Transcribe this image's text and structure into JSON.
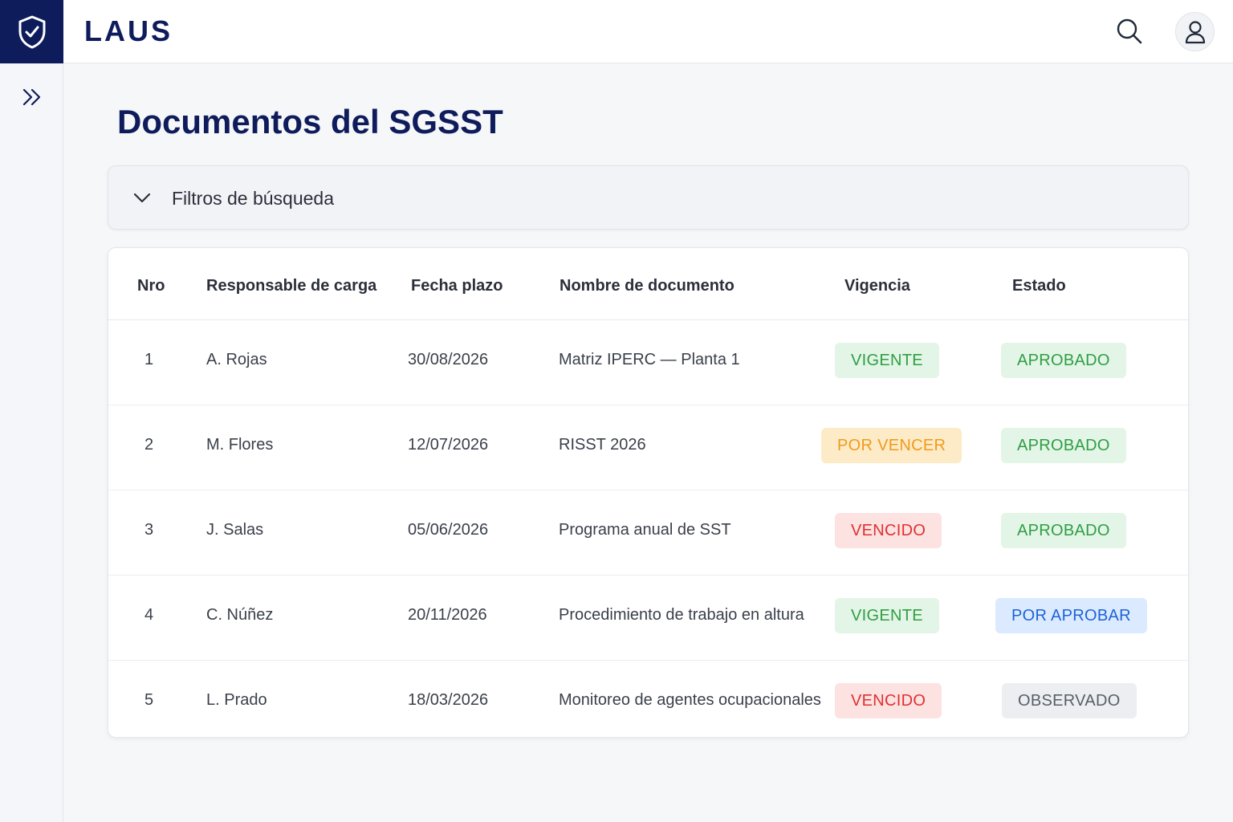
{
  "app": {
    "brand": "LAUS"
  },
  "page": {
    "title": "Documentos del SGSST"
  },
  "filters": {
    "label": "Filtros de búsqueda"
  },
  "table": {
    "headers": {
      "nro": "Nro",
      "responsable": "Responsable de carga",
      "fecha": "Fecha plazo",
      "nombre": "Nombre de documento",
      "vigencia": "Vigencia",
      "estado": "Estado"
    },
    "rows": [
      {
        "nro": "1",
        "responsable": "A. Rojas",
        "fecha": "30/08/2026",
        "nombre": "Matriz IPERC — Planta 1",
        "vigencia": "VIGENTE",
        "estado": "APROBADO"
      },
      {
        "nro": "2",
        "responsable": "M. Flores",
        "fecha": "12/07/2026",
        "nombre": "RISST 2026",
        "vigencia": "POR VENCER",
        "estado": "APROBADO"
      },
      {
        "nro": "3",
        "responsable": "J. Salas",
        "fecha": "05/06/2026",
        "nombre": "Programa anual de SST",
        "vigencia": "VENCIDO",
        "estado": "APROBADO"
      },
      {
        "nro": "4",
        "responsable": "C. Núñez",
        "fecha": "20/11/2026",
        "nombre": "Procedimiento de trabajo en altura",
        "vigencia": "VIGENTE",
        "estado": "POR APROBAR"
      },
      {
        "nro": "5",
        "responsable": "L. Prado",
        "fecha": "18/03/2026",
        "nombre": "Monitoreo de agentes ocupacionales",
        "vigencia": "VENCIDO",
        "estado": "OBSERVADO"
      }
    ]
  },
  "icons": {
    "logo": "shield-check-icon",
    "search": "search-icon",
    "user": "user-icon",
    "expand": "chevrons-right-icon",
    "filters": "chevron-down-icon"
  },
  "colors": {
    "brand": "#0f1c5c",
    "vigente": "#2f9e44",
    "por_vencer": "#f19a1a",
    "vencido": "#e03131",
    "por_aprobar": "#1d63d8",
    "observado": "#585e69"
  }
}
